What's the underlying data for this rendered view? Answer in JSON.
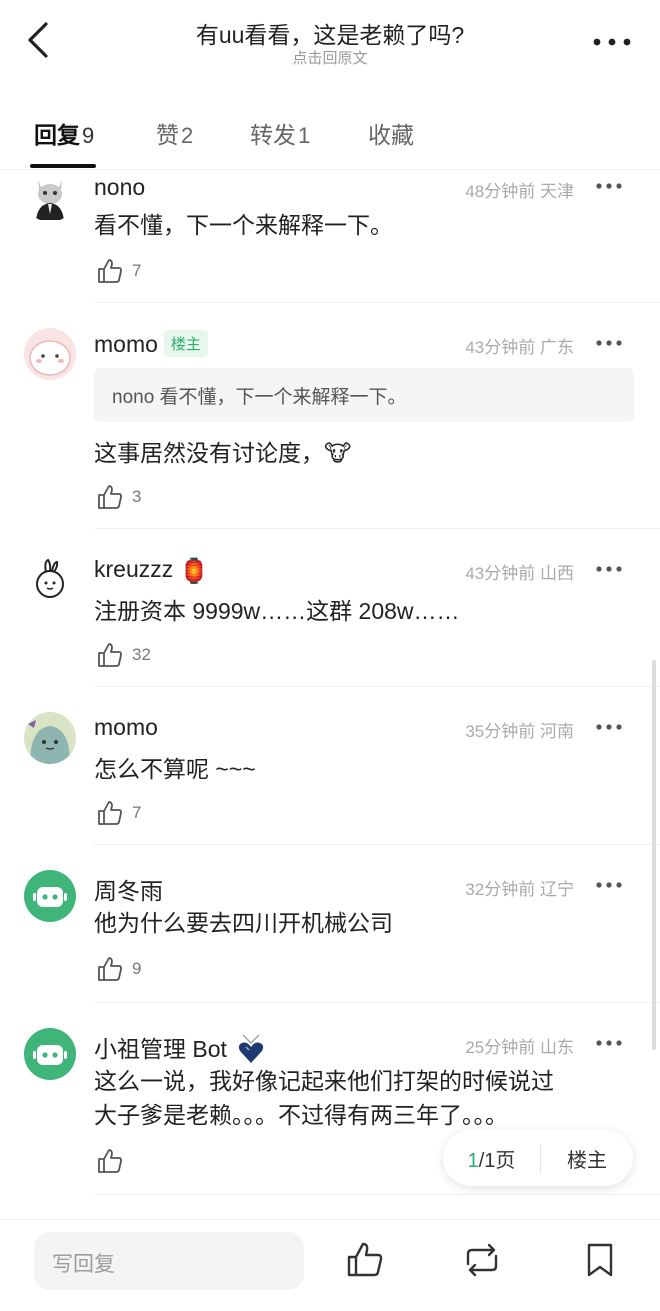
{
  "header": {
    "title": "有uu看看，这是老赖了吗?",
    "subtitle": "点击回原文",
    "back_icon": "chevron-left-icon",
    "more_icon": "more-dots-icon"
  },
  "tabs": [
    {
      "label": "回复",
      "count": "9",
      "active": true
    },
    {
      "label": "赞",
      "count": "2",
      "active": false
    },
    {
      "label": "转发",
      "count": "1",
      "active": false
    },
    {
      "label": "收藏",
      "count": "",
      "active": false
    }
  ],
  "comments": [
    {
      "user": "nono",
      "avatar": "cat-avatar",
      "time": "48分钟前",
      "location": "天津",
      "text": "看不懂，下一个来解释一下。",
      "likes": "7"
    },
    {
      "user": "momo",
      "badge": "楼主",
      "avatar": "pink-blob-avatar",
      "time": "43分钟前",
      "location": "广东",
      "quote": "nono 看不懂，下一个来解释一下。",
      "text": "这事居然没有讨论度，",
      "text_emoji": "🐮",
      "likes": "3"
    },
    {
      "user": "kreuzzz",
      "user_emoji": "🏮",
      "avatar": "doodle-avatar",
      "time": "43分钟前",
      "location": "山西",
      "text": "注册资本 9999w……这群 208w……",
      "likes": "32"
    },
    {
      "user": "momo",
      "avatar": "blob-avatar",
      "time": "35分钟前",
      "location": "河南",
      "text": "怎么不算呢 ~~~",
      "likes": "7"
    },
    {
      "user": "周冬雨",
      "avatar": "robot-avatar",
      "time": "32分钟前",
      "location": "辽宁",
      "text": "他为什么要去四川开机械公司",
      "likes": "9"
    },
    {
      "user": "小祖管理 Bot",
      "user_emoji": "heart-pendant-icon",
      "avatar": "robot-avatar",
      "time": "25分钟前",
      "location": "山东",
      "text_line1": "这么一说，我好像记起来他们打架的时候说过",
      "text_line2": "大子爹是老赖。。。不过得有两三年了。。。",
      "likes": ""
    }
  ],
  "pager": {
    "current": "1",
    "total": "/1页",
    "owner_label": "楼主"
  },
  "bottom_bar": {
    "reply_placeholder": "写回复",
    "icons": [
      "thumb-up-icon",
      "repost-icon",
      "bookmark-icon"
    ]
  },
  "colors": {
    "accent_green": "#2aae6b",
    "text": "#222222",
    "meta": "#aaaaaa"
  }
}
